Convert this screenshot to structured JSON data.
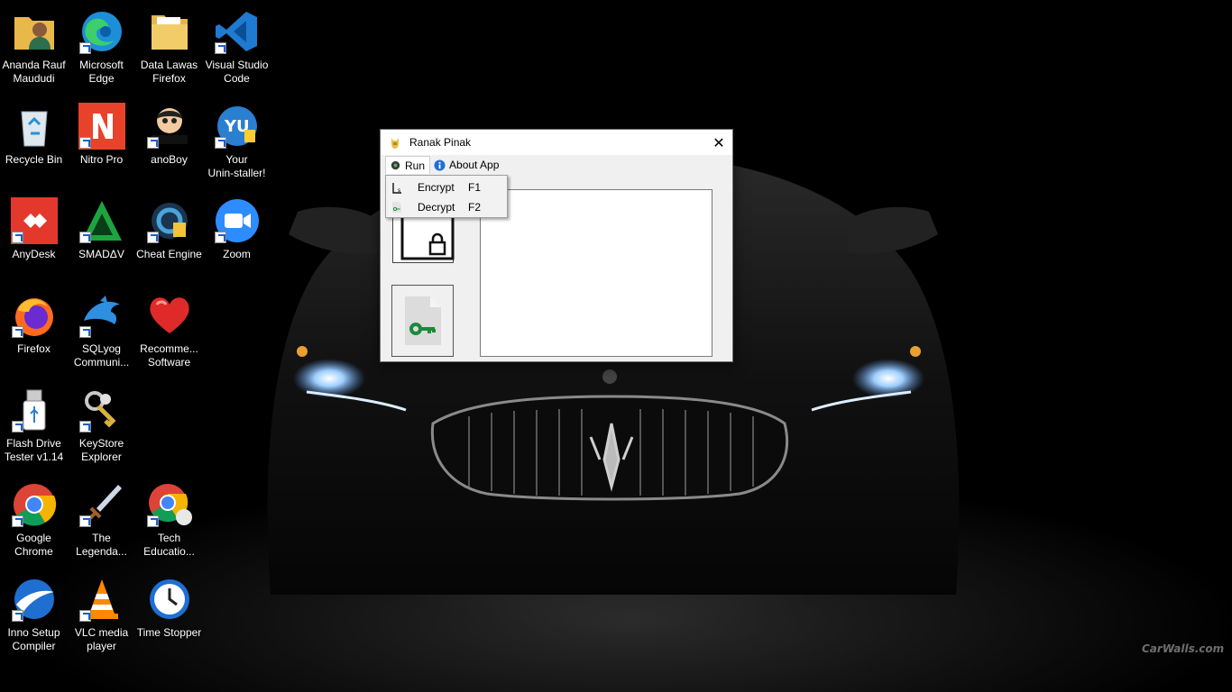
{
  "desktop": {
    "watermark": "CarWalls.com",
    "icons": [
      {
        "label": "Ananda Rauf\nMaududi",
        "icon": "user-folder-icon"
      },
      {
        "label": "Microsoft\nEdge",
        "icon": "edge-icon"
      },
      {
        "label": "Data Lawas\nFirefox",
        "icon": "folder-icon"
      },
      {
        "label": "Visual Studio\nCode",
        "icon": "vscode-icon"
      },
      {
        "label": "Recycle Bin",
        "icon": "recycle-bin-icon"
      },
      {
        "label": "Nitro Pro",
        "icon": "nitro-pro-icon"
      },
      {
        "label": "anoBoy",
        "icon": "anoboy-icon"
      },
      {
        "label": "Your\nUnin-staller!",
        "icon": "uninstaller-icon"
      },
      {
        "label": "AnyDesk",
        "icon": "anydesk-icon"
      },
      {
        "label": "SMADΔV",
        "icon": "smadav-icon"
      },
      {
        "label": "Cheat Engine",
        "icon": "cheat-engine-icon"
      },
      {
        "label": "Zoom",
        "icon": "zoom-icon"
      },
      {
        "label": "Firefox",
        "icon": "firefox-icon"
      },
      {
        "label": "SQLyog\nCommuni...",
        "icon": "sqlyog-icon"
      },
      {
        "label": "Recomme...\nSoftware",
        "icon": "heart-icon"
      },
      {
        "label": "Flash Drive\nTester v1.14",
        "icon": "usb-drive-icon"
      },
      {
        "label": "KeyStore\nExplorer",
        "icon": "keys-icon"
      },
      {
        "label": "Google\nChrome",
        "icon": "chrome-icon"
      },
      {
        "label": "The\nLegenda...",
        "icon": "sword-icon"
      },
      {
        "label": "Tech\nEducatio...",
        "icon": "chrome-profile-icon"
      },
      {
        "label": "Inno Setup\nCompiler",
        "icon": "inno-setup-icon"
      },
      {
        "label": "VLC media\nplayer",
        "icon": "vlc-icon"
      },
      {
        "label": "Time Stopper",
        "icon": "clock-icon"
      }
    ]
  },
  "window": {
    "title": "Ranak Pinak",
    "close": "✕",
    "menu": [
      {
        "label": "Run",
        "icon": "gear-icon"
      },
      {
        "label": "About App",
        "icon": "info-icon"
      }
    ],
    "dropdown": [
      {
        "label": "Encrypt",
        "shortcut": "F1",
        "icon": "encrypt-icon"
      },
      {
        "label": "Decrypt",
        "shortcut": "F2",
        "icon": "decrypt-icon"
      }
    ],
    "textarea_value": ""
  }
}
